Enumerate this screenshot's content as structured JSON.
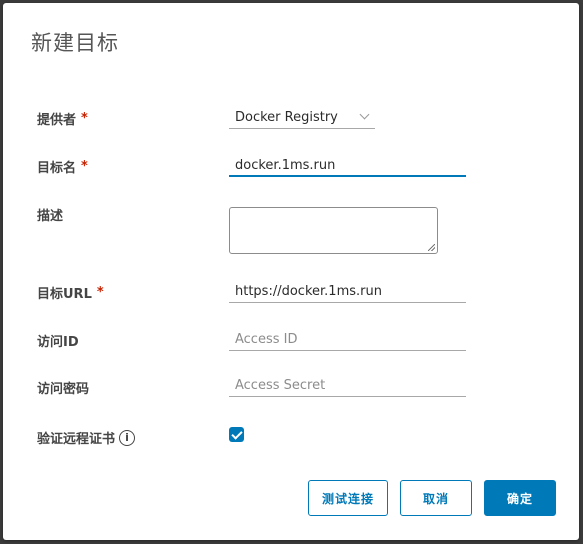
{
  "dialog": {
    "title": "新建目标",
    "fields": {
      "provider": {
        "label": "提供者",
        "required_mark": "*",
        "value": "Docker Registry"
      },
      "name": {
        "label": "目标名",
        "required_mark": "*",
        "value": "docker.1ms.run"
      },
      "description": {
        "label": "描述",
        "value": ""
      },
      "url": {
        "label": "目标URL",
        "required_mark": "*",
        "value": "https://docker.1ms.run"
      },
      "access_id": {
        "label": "访问ID",
        "placeholder": "Access ID"
      },
      "access_secret": {
        "label": "访问密码",
        "placeholder": "Access Secret"
      },
      "verify_cert": {
        "label": "验证远程证书",
        "info_icon": "i",
        "checked": true
      }
    },
    "buttons": {
      "test": "测试连接",
      "cancel": "取消",
      "ok": "确定"
    }
  },
  "colors": {
    "accent": "#0079b8",
    "required": "#c92100"
  },
  "icons": {
    "info": "info-icon",
    "dropdown": "chevron-down-icon",
    "check": "check-icon"
  }
}
